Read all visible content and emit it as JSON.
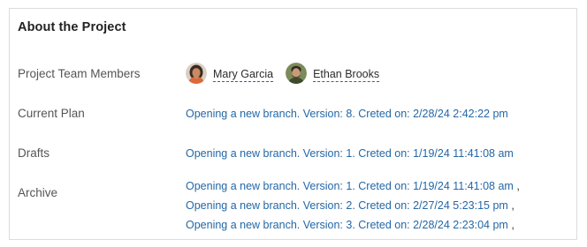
{
  "card": {
    "title": "About the Project"
  },
  "team": {
    "label": "Project Team Members",
    "members": [
      {
        "name": "Mary Garcia",
        "avatar_icon": "user-avatar-female-icon"
      },
      {
        "name": "Ethan Brooks",
        "avatar_icon": "user-avatar-male-icon"
      }
    ]
  },
  "current_plan": {
    "label": "Current Plan",
    "link": "Opening a new branch. Version: 8. Creted on: 2/28/24 2:42:22 pm"
  },
  "drafts": {
    "label": "Drafts",
    "link": "Opening a new branch. Version: 1. Creted on: 1/19/24 11:41:08 am"
  },
  "archive": {
    "label": "Archive",
    "separator": ",",
    "links": [
      "Opening a new branch. Version: 1. Creted on: 1/19/24 11:41:08 am",
      "Opening a new branch. Version: 2. Creted on: 2/27/24 5:23:15 pm",
      "Opening a new branch. Version: 3. Creted on: 2/28/24 2:23:04 pm"
    ]
  },
  "colors": {
    "link": "#2467a6",
    "border": "#dcdcdc",
    "label": "#555555"
  }
}
